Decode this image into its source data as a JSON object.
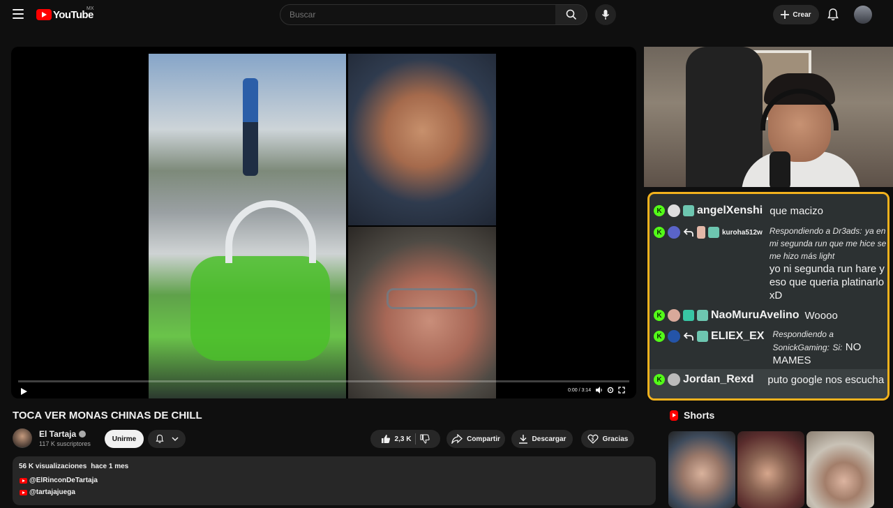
{
  "header": {
    "logo_text": "YouTube",
    "country": "MX",
    "search_placeholder": "Buscar",
    "create_label": "Crear"
  },
  "player": {
    "time": "0:00 / 3:14",
    "progress_fraction": 0.0
  },
  "chat": [
    {
      "user": "angelXenshi",
      "message": "que macizo",
      "reply_to": "",
      "reply_text": ""
    },
    {
      "user": "kuroha512w",
      "message": "yo ni segunda run hare y eso que queria platinarlo xD",
      "reply_to": "Respondiendo a Dr3ads:",
      "reply_text": "ya en mi segunda run que me hice se me hizo más light"
    },
    {
      "user": "NaoMuruAvelino",
      "message": "Woooo",
      "reply_to": "",
      "reply_text": ""
    },
    {
      "user": "ELIEX_EX",
      "message": "NO MAMES",
      "reply_to": "Respondiendo a SonickGaming:",
      "reply_text": "Si:"
    },
    {
      "user": "Jordan_Rexd",
      "message": "puto google nos escucha",
      "reply_to": "",
      "reply_text": ""
    }
  ],
  "video": {
    "title": "TOCA VER MONAS CHINAS DE CHILL",
    "channel": "El Tartaja",
    "subscribers": "117 K suscriptores",
    "join_label": "Unirme",
    "likes": "2,3 K",
    "share_label": "Compartir",
    "download_label": "Descargar",
    "thanks_label": "Gracias"
  },
  "description": {
    "views": "56 K visualizaciones",
    "date": "hace 1 mes",
    "links": [
      "@ElRinconDeTartaja",
      "@tartajajuega"
    ]
  },
  "shorts": {
    "title": "Shorts"
  },
  "colors": {
    "accent_red": "#ff0000",
    "chat_border": "#f3b21d",
    "kick_green": "#53fc18",
    "background": "#0f0f0f"
  }
}
